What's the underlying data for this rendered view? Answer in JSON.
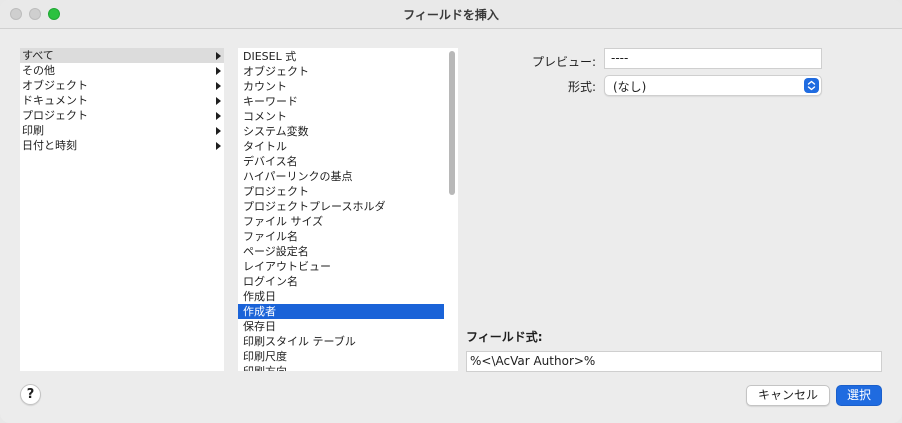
{
  "window": {
    "title": "フィールドを挿入"
  },
  "categories": [
    {
      "label": "すべて",
      "selected": true
    },
    {
      "label": "その他",
      "selected": false
    },
    {
      "label": "オブジェクト",
      "selected": false
    },
    {
      "label": "ドキュメント",
      "selected": false
    },
    {
      "label": "プロジェクト",
      "selected": false
    },
    {
      "label": "印刷",
      "selected": false
    },
    {
      "label": "日付と時刻",
      "selected": false
    }
  ],
  "fields": [
    {
      "label": "DIESEL 式"
    },
    {
      "label": "オブジェクト"
    },
    {
      "label": "カウント"
    },
    {
      "label": "キーワード"
    },
    {
      "label": "コメント"
    },
    {
      "label": "システム変数"
    },
    {
      "label": "タイトル"
    },
    {
      "label": "デバイス名"
    },
    {
      "label": "ハイパーリンクの基点"
    },
    {
      "label": "プロジェクト"
    },
    {
      "label": "プロジェクトプレースホルダ"
    },
    {
      "label": "ファイル サイズ"
    },
    {
      "label": "ファイル名"
    },
    {
      "label": "ページ設定名"
    },
    {
      "label": "レイアウトビュー"
    },
    {
      "label": "ログイン名"
    },
    {
      "label": "作成日"
    },
    {
      "label": "作成者",
      "selected": true
    },
    {
      "label": "保存日"
    },
    {
      "label": "印刷スタイル テーブル"
    },
    {
      "label": "印刷尺度"
    },
    {
      "label": "印刷方向"
    }
  ],
  "preview": {
    "label": "プレビュー:",
    "value": "----"
  },
  "format": {
    "label": "形式:",
    "value": "(なし)"
  },
  "expression": {
    "label": "フィールド式:",
    "value": "%<\\AcVar Author>%"
  },
  "buttons": {
    "help": "?",
    "cancel": "キャンセル",
    "select": "選択"
  },
  "colors": {
    "accent": "#1f6be0",
    "selection": "#1a63d8",
    "maximize": "#2bc140"
  },
  "icons": {
    "category_arrow": "triangle-right-icon",
    "select_stepper": "chevron-up-down-icon"
  }
}
